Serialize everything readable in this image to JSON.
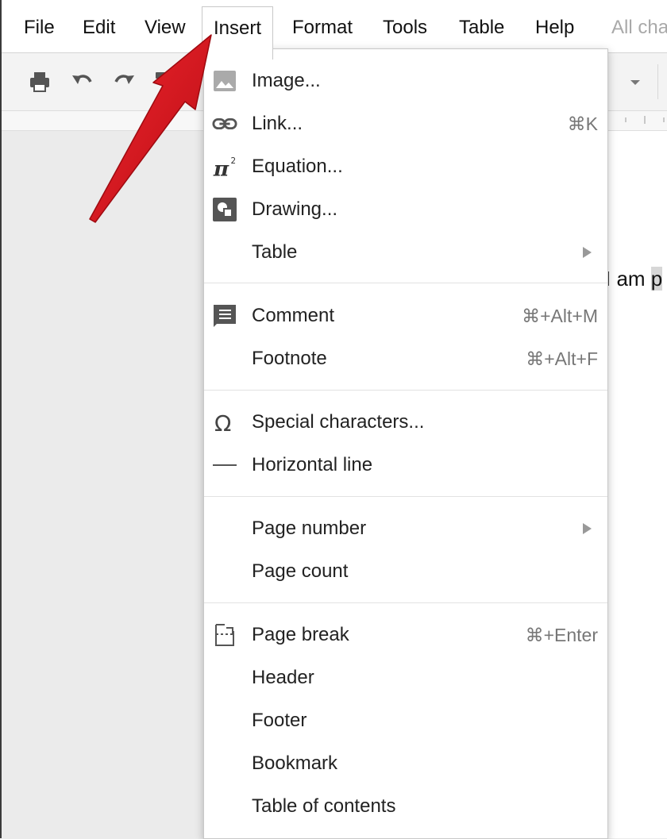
{
  "menubar": {
    "items": [
      {
        "label": "File"
      },
      {
        "label": "Edit"
      },
      {
        "label": "View"
      },
      {
        "label": "Insert"
      },
      {
        "label": "Format"
      },
      {
        "label": "Tools"
      },
      {
        "label": "Table"
      },
      {
        "label": "Help"
      }
    ],
    "status_text": "All cha"
  },
  "toolbar": {
    "icons": [
      "print-icon",
      "undo-icon",
      "redo-icon",
      "paint-format-icon",
      "dropdown-caret-icon"
    ]
  },
  "document": {
    "text_before": "I am ",
    "text_selected": "p"
  },
  "insert_menu": {
    "groups": [
      [
        {
          "label": "Image...",
          "icon": "image-icon"
        },
        {
          "label": "Link...",
          "icon": "link-icon",
          "shortcut": "⌘K"
        },
        {
          "label": "Equation...",
          "icon": "equation-icon"
        },
        {
          "label": "Drawing...",
          "icon": "drawing-icon"
        },
        {
          "label": "Table",
          "submenu": true
        }
      ],
      [
        {
          "label": "Comment",
          "icon": "comment-icon",
          "shortcut": "⌘+Alt+M"
        },
        {
          "label": "Footnote",
          "shortcut": "⌘+Alt+F"
        }
      ],
      [
        {
          "label": "Special characters...",
          "icon": "omega-icon"
        },
        {
          "label": "Horizontal line",
          "icon": "horizontal-line-icon"
        }
      ],
      [
        {
          "label": "Page number",
          "submenu": true
        },
        {
          "label": "Page count"
        }
      ],
      [
        {
          "label": "Page break",
          "icon": "page-break-icon",
          "shortcut": "⌘+Enter"
        },
        {
          "label": "Header"
        },
        {
          "label": "Footer"
        },
        {
          "label": "Bookmark"
        },
        {
          "label": "Table of contents"
        }
      ]
    ]
  },
  "colors": {
    "annotation_arrow": "#e2121c",
    "menu_text": "#222222",
    "shortcut_text": "#777777"
  }
}
